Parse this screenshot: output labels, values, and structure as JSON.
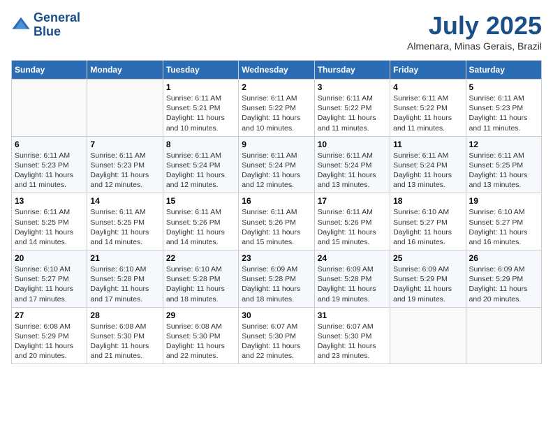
{
  "header": {
    "logo_line1": "General",
    "logo_line2": "Blue",
    "month": "July 2025",
    "location": "Almenara, Minas Gerais, Brazil"
  },
  "days_of_week": [
    "Sunday",
    "Monday",
    "Tuesday",
    "Wednesday",
    "Thursday",
    "Friday",
    "Saturday"
  ],
  "weeks": [
    [
      {
        "day": "",
        "info": ""
      },
      {
        "day": "",
        "info": ""
      },
      {
        "day": "1",
        "info": "Sunrise: 6:11 AM\nSunset: 5:21 PM\nDaylight: 11 hours and 10 minutes."
      },
      {
        "day": "2",
        "info": "Sunrise: 6:11 AM\nSunset: 5:22 PM\nDaylight: 11 hours and 10 minutes."
      },
      {
        "day": "3",
        "info": "Sunrise: 6:11 AM\nSunset: 5:22 PM\nDaylight: 11 hours and 11 minutes."
      },
      {
        "day": "4",
        "info": "Sunrise: 6:11 AM\nSunset: 5:22 PM\nDaylight: 11 hours and 11 minutes."
      },
      {
        "day": "5",
        "info": "Sunrise: 6:11 AM\nSunset: 5:23 PM\nDaylight: 11 hours and 11 minutes."
      }
    ],
    [
      {
        "day": "6",
        "info": "Sunrise: 6:11 AM\nSunset: 5:23 PM\nDaylight: 11 hours and 11 minutes."
      },
      {
        "day": "7",
        "info": "Sunrise: 6:11 AM\nSunset: 5:23 PM\nDaylight: 11 hours and 12 minutes."
      },
      {
        "day": "8",
        "info": "Sunrise: 6:11 AM\nSunset: 5:24 PM\nDaylight: 11 hours and 12 minutes."
      },
      {
        "day": "9",
        "info": "Sunrise: 6:11 AM\nSunset: 5:24 PM\nDaylight: 11 hours and 12 minutes."
      },
      {
        "day": "10",
        "info": "Sunrise: 6:11 AM\nSunset: 5:24 PM\nDaylight: 11 hours and 13 minutes."
      },
      {
        "day": "11",
        "info": "Sunrise: 6:11 AM\nSunset: 5:24 PM\nDaylight: 11 hours and 13 minutes."
      },
      {
        "day": "12",
        "info": "Sunrise: 6:11 AM\nSunset: 5:25 PM\nDaylight: 11 hours and 13 minutes."
      }
    ],
    [
      {
        "day": "13",
        "info": "Sunrise: 6:11 AM\nSunset: 5:25 PM\nDaylight: 11 hours and 14 minutes."
      },
      {
        "day": "14",
        "info": "Sunrise: 6:11 AM\nSunset: 5:25 PM\nDaylight: 11 hours and 14 minutes."
      },
      {
        "day": "15",
        "info": "Sunrise: 6:11 AM\nSunset: 5:26 PM\nDaylight: 11 hours and 14 minutes."
      },
      {
        "day": "16",
        "info": "Sunrise: 6:11 AM\nSunset: 5:26 PM\nDaylight: 11 hours and 15 minutes."
      },
      {
        "day": "17",
        "info": "Sunrise: 6:11 AM\nSunset: 5:26 PM\nDaylight: 11 hours and 15 minutes."
      },
      {
        "day": "18",
        "info": "Sunrise: 6:10 AM\nSunset: 5:27 PM\nDaylight: 11 hours and 16 minutes."
      },
      {
        "day": "19",
        "info": "Sunrise: 6:10 AM\nSunset: 5:27 PM\nDaylight: 11 hours and 16 minutes."
      }
    ],
    [
      {
        "day": "20",
        "info": "Sunrise: 6:10 AM\nSunset: 5:27 PM\nDaylight: 11 hours and 17 minutes."
      },
      {
        "day": "21",
        "info": "Sunrise: 6:10 AM\nSunset: 5:28 PM\nDaylight: 11 hours and 17 minutes."
      },
      {
        "day": "22",
        "info": "Sunrise: 6:10 AM\nSunset: 5:28 PM\nDaylight: 11 hours and 18 minutes."
      },
      {
        "day": "23",
        "info": "Sunrise: 6:09 AM\nSunset: 5:28 PM\nDaylight: 11 hours and 18 minutes."
      },
      {
        "day": "24",
        "info": "Sunrise: 6:09 AM\nSunset: 5:28 PM\nDaylight: 11 hours and 19 minutes."
      },
      {
        "day": "25",
        "info": "Sunrise: 6:09 AM\nSunset: 5:29 PM\nDaylight: 11 hours and 19 minutes."
      },
      {
        "day": "26",
        "info": "Sunrise: 6:09 AM\nSunset: 5:29 PM\nDaylight: 11 hours and 20 minutes."
      }
    ],
    [
      {
        "day": "27",
        "info": "Sunrise: 6:08 AM\nSunset: 5:29 PM\nDaylight: 11 hours and 20 minutes."
      },
      {
        "day": "28",
        "info": "Sunrise: 6:08 AM\nSunset: 5:30 PM\nDaylight: 11 hours and 21 minutes."
      },
      {
        "day": "29",
        "info": "Sunrise: 6:08 AM\nSunset: 5:30 PM\nDaylight: 11 hours and 22 minutes."
      },
      {
        "day": "30",
        "info": "Sunrise: 6:07 AM\nSunset: 5:30 PM\nDaylight: 11 hours and 22 minutes."
      },
      {
        "day": "31",
        "info": "Sunrise: 6:07 AM\nSunset: 5:30 PM\nDaylight: 11 hours and 23 minutes."
      },
      {
        "day": "",
        "info": ""
      },
      {
        "day": "",
        "info": ""
      }
    ]
  ]
}
